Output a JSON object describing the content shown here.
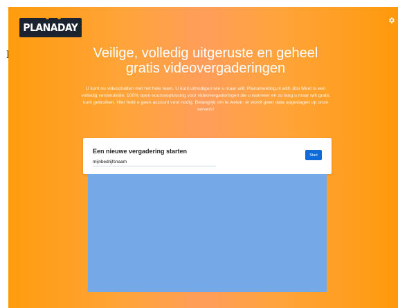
{
  "page": {
    "stray_char": "l",
    "logo_text": "PLANADAY"
  },
  "header": {
    "settings_icon": "gear-icon"
  },
  "hero": {
    "title": "Veilige, volledig uitgeruste en geheel gratis videovergaderingen",
    "intro": "U kunt nu videochatten met het hele team. U kunt uitnodigen wie u maar wilt. Planameeting.nl with Jitsi Meet is een volledig versleutelde, 100% open-sourceoplossing voor videovergaderingen die u wanneer en zo lang u maar wilt gratis kunt gebruiken. Hier hebt u geen account voor nodig. Belangrijk om te weten: er wordt geen data opgeslagen op onze servers!"
  },
  "new_meeting": {
    "title": "Een nieuwe vergadering starten",
    "room_value": "mijnbedrijfsnaam",
    "start_label": "Start"
  },
  "colors": {
    "hero_orange": "#ff9c0e",
    "start_button": "#0e6bd8",
    "video_panel": "#75a8e7",
    "logo_bg": "#1c2330"
  }
}
